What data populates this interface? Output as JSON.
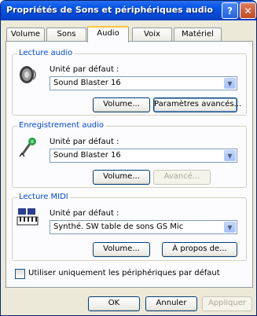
{
  "window": {
    "title": "Propriétés de Sons et périphériques audio",
    "help_label": "?",
    "close_label": "✕"
  },
  "tabs": [
    {
      "label": "Volume"
    },
    {
      "label": "Sons"
    },
    {
      "label": "Audio"
    },
    {
      "label": "Voix"
    },
    {
      "label": "Matériel"
    }
  ],
  "playback": {
    "legend": "Lecture audio",
    "default_label": "Unité par défaut :",
    "device": "Sound Blaster 16",
    "volume_label": "Volume...",
    "advanced_label": "Paramètres avancés..."
  },
  "recording": {
    "legend": "Enregistrement audio",
    "default_label": "Unité par défaut :",
    "device": "Sound Blaster 16",
    "volume_label": "Volume...",
    "advanced_label": "Avancé..."
  },
  "midi": {
    "legend": "Lecture MIDI",
    "default_label": "Unité par défaut :",
    "device": "Synthé. SW table de sons GS Mic",
    "volume_label": "Volume...",
    "about_label": "À propos de..."
  },
  "options": {
    "default_only_label": "Utiliser uniquement les périphériques par défaut"
  },
  "footer": {
    "ok_label": "OK",
    "cancel_label": "Annuler",
    "apply_label": "Appliquer"
  }
}
